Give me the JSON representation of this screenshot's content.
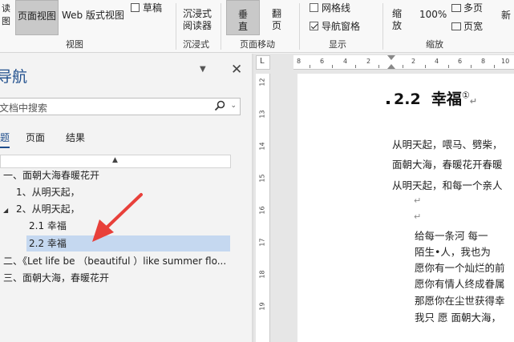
{
  "ribbon": {
    "view_group": {
      "focus_tail": "读",
      "focus_tail2": "图",
      "page_view": "页面视图",
      "web_layout": "Web 版式视图",
      "draft": "草稿",
      "label": "视图"
    },
    "immersive_group": {
      "immersive_reader_line1": "沉浸式",
      "immersive_reader_line2": "阅读器",
      "label": "沉浸式"
    },
    "page_movement_group": {
      "vertical_line1": "垂",
      "vertical_line2": "直",
      "side_line1": "翻",
      "side_line2": "页",
      "label": "页面移动"
    },
    "show_group": {
      "gridlines": "网格线",
      "gridlines_checked": false,
      "navigation_pane": "导航窗格",
      "navigation_pane_checked": true,
      "label": "显示"
    },
    "zoom_group": {
      "zoom_line1": "缩",
      "zoom_line2": "放",
      "zoom_100": "100%",
      "multiple_pages": "多页",
      "page_width": "页宽",
      "new_window_partial": "新",
      "label": "缩放"
    }
  },
  "nav": {
    "title_partial": "导航",
    "search_placeholder": "文档中搜索",
    "tabs": [
      "题",
      "页面",
      "结果"
    ],
    "active_tab_index": 0,
    "tree": [
      {
        "text": "一、面朝大海春暖花开",
        "level": 0,
        "expanded": null,
        "selected": false
      },
      {
        "text": "1、从明天起，",
        "level": 1,
        "expanded": null,
        "selected": false
      },
      {
        "text": "2、从明天起，",
        "level": 1,
        "expanded": true,
        "selected": false
      },
      {
        "text": "2.1 幸福",
        "level": 2,
        "expanded": null,
        "selected": false
      },
      {
        "text": "2.2 幸福",
        "level": 2,
        "expanded": null,
        "selected": true
      },
      {
        "text": "二、《Let life be （beautiful ）like summer flo...",
        "level": 0,
        "expanded": null,
        "selected": false
      },
      {
        "text": "三、面朝大海，春暖花开",
        "level": 0,
        "expanded": null,
        "selected": false
      }
    ]
  },
  "ruler": {
    "horizontal_numbers": [
      "8",
      "6",
      "4",
      "2",
      "2",
      "4",
      "6",
      "8",
      "10",
      "12"
    ],
    "vertical_numbers": [
      "12",
      "13",
      "14",
      "15",
      "16",
      "17",
      "18",
      "19"
    ],
    "corner_symbol": "L"
  },
  "document": {
    "heading_number": "2.2",
    "heading_text": "幸福",
    "heading_footnote": "①",
    "lines": [
      "从明天起，喂马、劈柴，",
      "面朝大海，春暖花开春暖",
      "从明天起，和每一个亲人",
      "",
      "",
      "给每一条河      每一",
      "陌生•人，我也为",
      "愿你有一个灿烂的前",
      "愿你有情人终成眷属",
      "那愿你在尘世获得幸",
      "我只  愿  面朝大海，"
    ],
    "paragraph_mark": "↵"
  },
  "colors": {
    "accent": "#1f4e8c",
    "selection": "#c5d8f0",
    "annotation_arrow": "#e8403a"
  }
}
